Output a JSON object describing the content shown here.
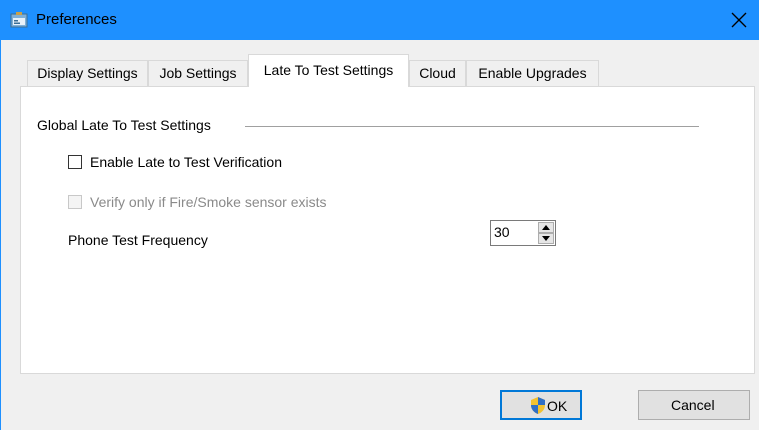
{
  "window": {
    "title": "Preferences"
  },
  "colors": {
    "titlebar": "#1e90ff",
    "default_button_border": "#0078d7"
  },
  "icons": {
    "app": "preferences-app-icon",
    "close": "close-icon",
    "shield": "uac-shield-icon"
  },
  "tabs": [
    {
      "label": "Display Settings"
    },
    {
      "label": "Job Settings"
    },
    {
      "label": "Late To Test Settings",
      "active": true
    },
    {
      "label": "Cloud"
    },
    {
      "label": "Enable Upgrades"
    }
  ],
  "group": {
    "title": "Global Late To Test Settings"
  },
  "options": {
    "enable_verification": {
      "label": "Enable Late to Test Verification",
      "checked": false,
      "enabled": true
    },
    "verify_fire_smoke": {
      "label": "Verify only if Fire/Smoke sensor exists",
      "checked": false,
      "enabled": false
    }
  },
  "phone_test": {
    "label": "Phone Test Frequency",
    "value": "30"
  },
  "buttons": {
    "ok": "OK",
    "cancel": "Cancel"
  }
}
